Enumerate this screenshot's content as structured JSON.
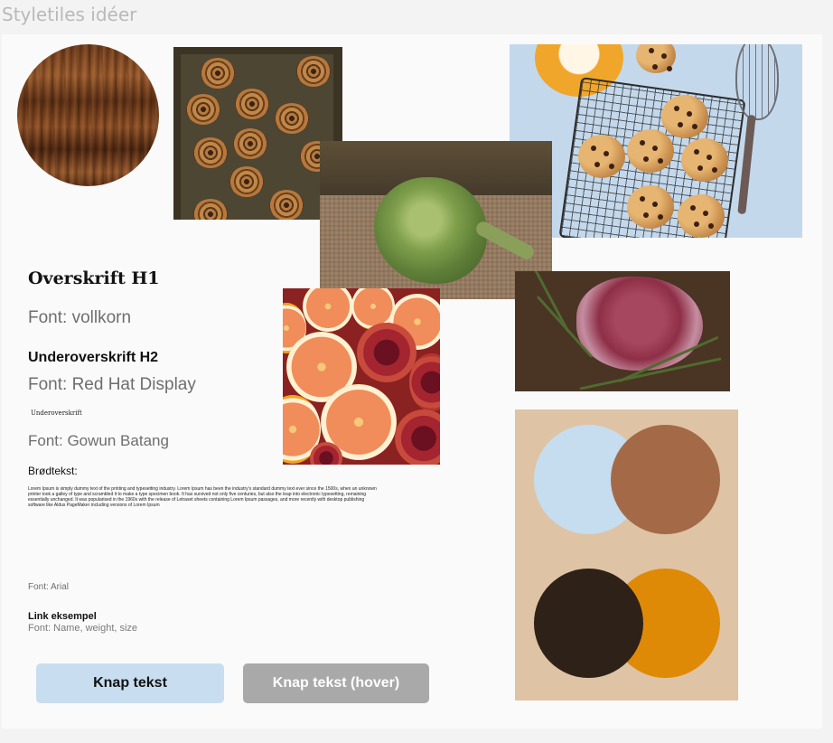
{
  "frame_title": "Styletiles idéer",
  "typography": {
    "h1_sample": "Overskrift H1",
    "h1_font": "Font: vollkorn",
    "h2_sample": "Underoverskrift H2",
    "h2_font": "Font: Red Hat Display",
    "h3_sample": "Underoverskrift",
    "h3_font": "Font: Gowun Batang",
    "body_label": "Brødtekst:",
    "body_sample": "Lorem Ipsum is simply dummy text of the printing and typesetting industry. Lorem Ipsum has been the industry's standard dummy text ever since the 1500s, when an unknown printer took a galley of type and scrambled it to make a type specimen book. It has survived not only five centuries, but also the leap into electronic typesetting, remaining essentially unchanged. It was popularised in the 1960s with the release of Letraset sheets containing Lorem Ipsum passages, and more recently with desktop publishing software like Aldus PageMaker including versions of Lorem Ipsum",
    "body_font": "Font: Arial",
    "link_sample": "Link eksempel",
    "link_font": "Font: Name, weight, size"
  },
  "buttons": {
    "primary_label": "Knap tekst",
    "hover_label": "Knap tekst (hover)"
  },
  "palette": {
    "colors": [
      "#c6dcef",
      "#a46a48",
      "#2e2118",
      "#df8a06"
    ],
    "background": "#dfc3a5"
  },
  "images": [
    "wood-texture",
    "cinnamon-rolls",
    "cookies-on-rack",
    "artichoke",
    "citrus-and-pomegranate",
    "raw-meat-with-rosemary"
  ]
}
